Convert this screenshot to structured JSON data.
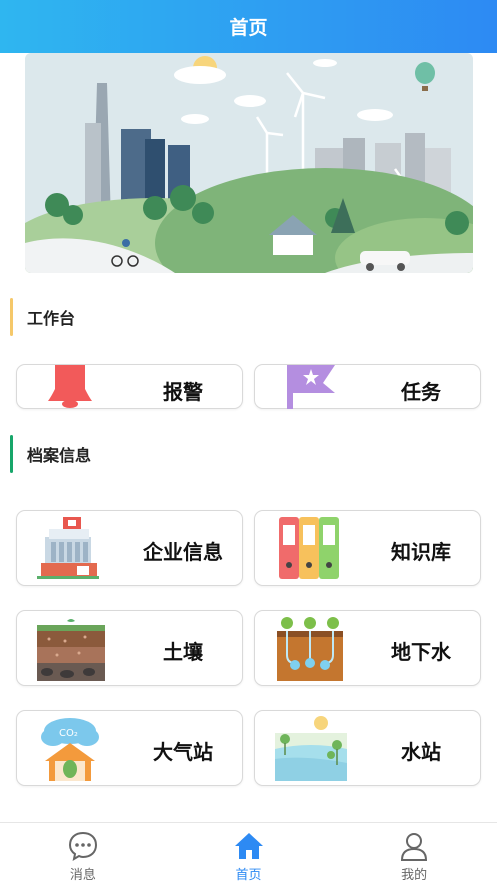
{
  "header": {
    "title": "首页"
  },
  "workbench": {
    "title": "工作台",
    "accent": "#f5c86a",
    "items": [
      {
        "label": "报警",
        "icon": "bell-icon"
      },
      {
        "label": "任务",
        "icon": "flag-icon"
      }
    ]
  },
  "archive": {
    "title": "档案信息",
    "accent": "#17a66a",
    "items": [
      {
        "label": "企业信息",
        "icon": "factory-icon"
      },
      {
        "label": "知识库",
        "icon": "binders-icon"
      },
      {
        "label": "土壤",
        "icon": "soil-icon"
      },
      {
        "label": "地下水",
        "icon": "groundwater-icon"
      },
      {
        "label": "大气站",
        "icon": "air-station-icon"
      },
      {
        "label": "水站",
        "icon": "water-station-icon"
      }
    ]
  },
  "tabbar": {
    "tabs": [
      {
        "label": "消息",
        "icon": "chat-icon"
      },
      {
        "label": "首页",
        "icon": "home-icon"
      },
      {
        "label": "我的",
        "icon": "user-icon"
      }
    ],
    "active_color": "#2d8af3",
    "inactive_color": "#666666"
  }
}
